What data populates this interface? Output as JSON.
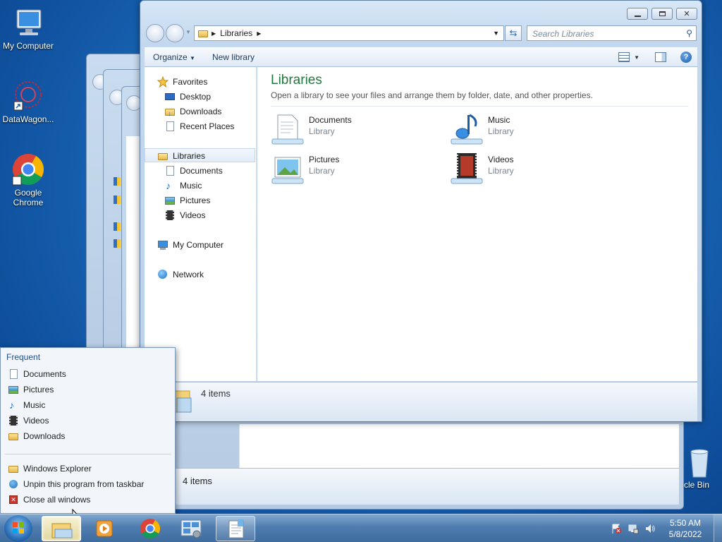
{
  "desktop": {
    "icons": [
      {
        "label": "My Computer",
        "icon": "computer-icon"
      },
      {
        "label": "DataWagon...",
        "icon": "datawagon-icon"
      },
      {
        "label": "Google Chrome",
        "icon": "chrome-icon"
      },
      {
        "label": "cle Bin",
        "icon": "recycle-bin-icon"
      }
    ]
  },
  "background_window": {
    "status": "4 items"
  },
  "explorer": {
    "address": {
      "crumb": "Libraries"
    },
    "search_placeholder": "Search Libraries",
    "toolbar": {
      "organize": "Organize",
      "new_library": "New library"
    },
    "nav": {
      "favorites": "Favorites",
      "desktop": "Desktop",
      "downloads": "Downloads",
      "recent_places": "Recent Places",
      "libraries": "Libraries",
      "documents": "Documents",
      "music": "Music",
      "pictures": "Pictures",
      "videos": "Videos",
      "my_computer": "My Computer",
      "network": "Network"
    },
    "content": {
      "title": "Libraries",
      "subtitle": "Open a library to see your files and arrange them by folder, date, and other properties.",
      "items": [
        {
          "name": "Documents",
          "type": "Library"
        },
        {
          "name": "Music",
          "type": "Library"
        },
        {
          "name": "Pictures",
          "type": "Library"
        },
        {
          "name": "Videos",
          "type": "Library"
        }
      ]
    },
    "details": {
      "count": "4 items"
    }
  },
  "jumplist": {
    "header": "Frequent",
    "frequent": [
      "Documents",
      "Pictures",
      "Music",
      "Videos",
      "Downloads"
    ],
    "tasks": [
      "Windows Explorer",
      "Unpin this program from taskbar",
      "Close all windows"
    ]
  },
  "taskbar": {
    "time": "5:50 AM",
    "date": "5/8/2022"
  },
  "colors": {
    "title_green": "#1e7a3e",
    "taskbar": "#4f7daf"
  }
}
